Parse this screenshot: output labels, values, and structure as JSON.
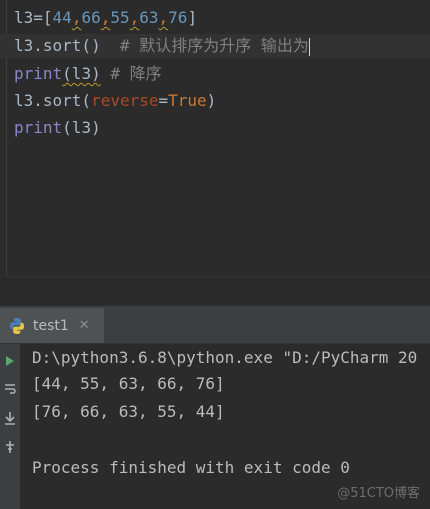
{
  "editor": {
    "lines": [
      {
        "var": "l3",
        "eq": "=",
        "open": "[",
        "nums": [
          "44",
          "66",
          "55",
          "63",
          "76"
        ],
        "comma": ",",
        "close": "]"
      },
      {
        "call": "l3.sort()",
        "comment": "# 默认排序为升序 输出为"
      },
      {
        "print": "print",
        "arg": "(l3)",
        "comment": "# 降序"
      },
      {
        "call": "l3.sort(",
        "param": "reverse",
        "eq": "=",
        "value": "True",
        "close": ")"
      },
      {
        "print": "print",
        "arg": "(l3)"
      }
    ]
  },
  "run_panel": {
    "tab_label": "test1",
    "close_glyph": "✕",
    "output": [
      "D:\\python3.6.8\\python.exe \"D:/PyCharm 20",
      "[44, 55, 63, 66, 76]",
      "[76, 66, 63, 55, 44]",
      "",
      "Process finished with exit code 0"
    ],
    "toolbar_icons": [
      "rerun-icon",
      "soft-wrap-icon",
      "scroll-to-end-icon",
      "pin-icon"
    ]
  },
  "watermark": "@51CTO博客",
  "colors": {
    "background": "#2b2b2b",
    "keyword": "#cc7832",
    "number": "#6897bb",
    "comment": "#808080",
    "builtin": "#8888c6",
    "param": "#aa4926",
    "text": "#a9b7c6"
  }
}
